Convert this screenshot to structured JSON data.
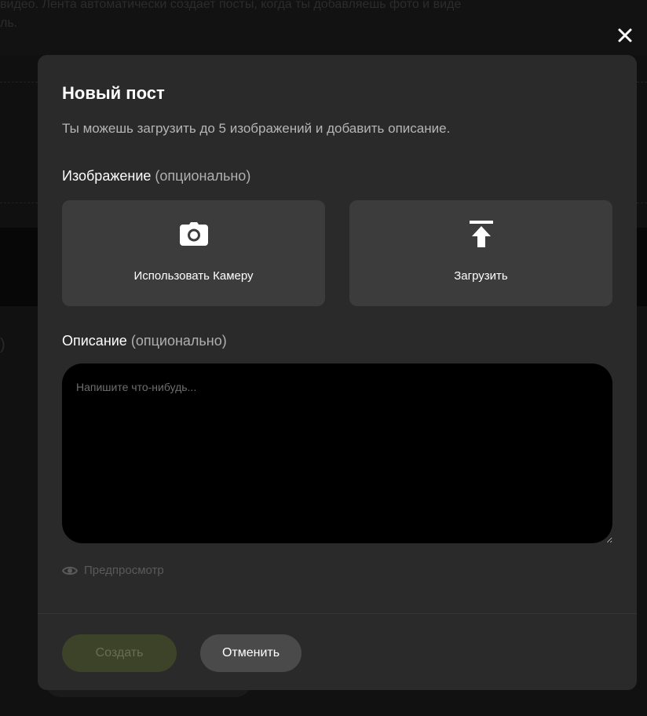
{
  "background": {
    "text_line1": "видео. Лента автоматически создает посты, когда ты добавляешь фото и виде",
    "text_line2": "ль.",
    "edge_char": ")"
  },
  "modal": {
    "title": "Новый пост",
    "subtitle": "Ты можешь загрузить до 5 изображений и добавить описание.",
    "close_icon": "close-icon",
    "image_section": {
      "label": "Изображение",
      "optional": "(опционально)",
      "buttons": [
        {
          "icon": "camera-icon",
          "label": "Использовать Камеру"
        },
        {
          "icon": "upload-icon",
          "label": "Загрузить"
        }
      ]
    },
    "description_section": {
      "label": "Описание",
      "optional": "(опционально)",
      "placeholder": "Напишите что-нибудь...",
      "value": ""
    },
    "preview": {
      "icon": "eye-icon",
      "label": "Предпросмотр"
    },
    "footer": {
      "create_label": "Создать",
      "create_disabled": true,
      "cancel_label": "Отменить"
    }
  },
  "colors": {
    "modal_bg": "#2a2a2a",
    "tile_bg": "#3c3c3c",
    "create_disabled_bg": "#3c4329",
    "cancel_bg": "#4a4a4a"
  }
}
